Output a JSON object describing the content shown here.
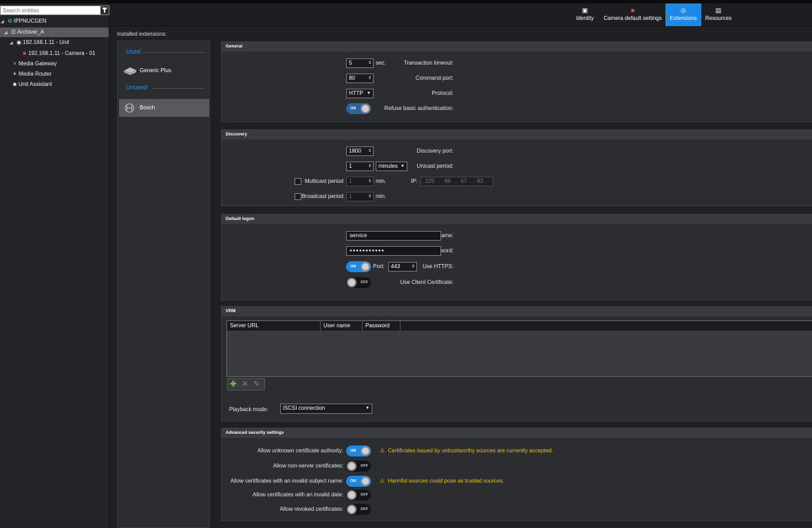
{
  "search": {
    "placeholder": "Search entities"
  },
  "tree": [
    {
      "label": "IPPNUCGEN",
      "icon": "server-icon"
    },
    {
      "label": "Archiver_A",
      "icon": "archiver-icon"
    },
    {
      "label": "192.168.1.11 - Unit",
      "icon": "unit-icon"
    },
    {
      "label": "192.168.1.11 - Camera - 01",
      "icon": "camera-icon"
    },
    {
      "label": "Media Gateway",
      "icon": "media-gateway-icon"
    },
    {
      "label": "Media Router",
      "icon": "media-router-icon"
    },
    {
      "label": "Unit Assistant",
      "icon": "unit-assistant-icon"
    }
  ],
  "tabs": [
    {
      "label": "Identity"
    },
    {
      "label": "Camera default settings"
    },
    {
      "label": "Extensions"
    },
    {
      "label": "Resources"
    }
  ],
  "installed_label": "Installed extensions:",
  "ext": {
    "used_label": "Used",
    "unused_label": "Unused",
    "used_items": [
      "Generic Plus"
    ],
    "unused_items": [
      "Bosch"
    ]
  },
  "general": {
    "title": "General",
    "transaction_timeout_label": "Transaction timeout:",
    "transaction_timeout": "5",
    "transaction_timeout_unit": "sec.",
    "command_port_label": "Command port:",
    "command_port": "80",
    "protocol_label": "Protocol:",
    "protocol": "HTTP",
    "refuse_basic_label": "Refuse basic authentication:",
    "refuse_basic": "ON"
  },
  "discovery": {
    "title": "Discovery",
    "discovery_port_label": "Discovery port:",
    "discovery_port": "1800",
    "unicast_label": "Unicast period:",
    "unicast_value": "1",
    "unicast_unit": "minutes",
    "multicast_label": "Multicast period",
    "multicast_value": "1",
    "multicast_unit": "min.",
    "ip_label": "IP:",
    "ip_value": "225 . 86 . 67 . 83",
    "broadcast_label": "Broadcast period",
    "broadcast_value": "1",
    "broadcast_unit": "min."
  },
  "logon": {
    "title": "Default logon",
    "username_label": "Username:",
    "username": "service",
    "password_label": "Password:",
    "password": "●●●●●●●●●●●",
    "https_label": "Use HTTPS:",
    "https": "ON",
    "port_label": "Port:",
    "port": "443",
    "client_cert_label": "Use Client Certificate:",
    "client_cert": "OFF"
  },
  "vrm": {
    "title": "VRM",
    "columns": [
      "Server URL",
      "User name",
      "Password"
    ],
    "playback_label": "Playback mode:",
    "playback_value": "iSCSI connection"
  },
  "security": {
    "title": "Advanced security settings",
    "items": [
      {
        "label": "Allow unknown certificate authority:",
        "state": "ON",
        "warning": "Certificates issued by untrustworthy sources are currently accepted."
      },
      {
        "label": "Allow non-server certificates:",
        "state": "OFF",
        "warning": ""
      },
      {
        "label": "Allow certificates with an invalid subject name:",
        "state": "ON",
        "warning": "Harmful sources could pose as trusted sources."
      },
      {
        "label": "Allow certificates with an invalid date:",
        "state": "OFF",
        "warning": ""
      },
      {
        "label": "Allow revoked certificates:",
        "state": "OFF",
        "warning": ""
      }
    ]
  },
  "colors": {
    "accent": "#1e88e5",
    "warning": "#e8c21a",
    "section_label": "#2f8ee0"
  }
}
